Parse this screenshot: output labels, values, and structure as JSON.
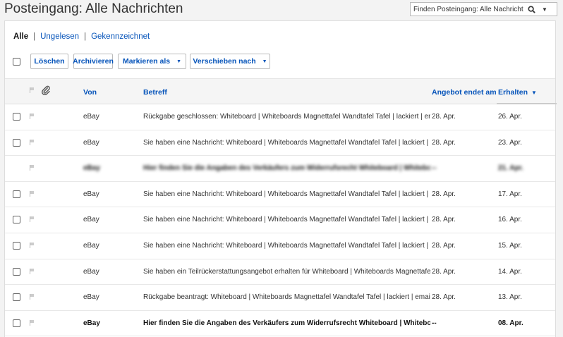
{
  "header": {
    "title": "Posteingang: Alle Nachrichten",
    "search_placeholder": "Finden Posteingang: Alle Nachrichten"
  },
  "filters": {
    "all": "Alle",
    "unread": "Ungelesen",
    "flagged": "Gekennzeichnet",
    "separator": "|"
  },
  "toolbar": {
    "delete": "Löschen",
    "archive": "Archivieren",
    "mark_as": "Markieren als",
    "move_to": "Verschieben nach"
  },
  "table": {
    "columns": {
      "from": "Von",
      "subject": "Betreff",
      "offer_ends": "Angebot endet am",
      "received": "Erhalten"
    },
    "sort_indicator": "▼",
    "rows": [
      {
        "sender": "eBay",
        "subject": "Rückgabe geschlossen: Whiteboard | Whiteboards Magnettafel Wandtafel Tafel | lackiert | emaillier",
        "ends": "28. Apr.",
        "received": "26. Apr.",
        "bold": false,
        "blurred": false
      },
      {
        "sender": "eBay",
        "subject": "Sie haben eine Nachricht: Whiteboard | Whiteboards Magnettafel Wandtafel Tafel | lackiert | emai",
        "ends": "28. Apr.",
        "received": "23. Apr.",
        "bold": false,
        "blurred": false
      },
      {
        "sender": "eBay",
        "subject": "Hier finden Sie die Angaben des Verkäufers zum Widerrufsrecht Whiteboard | Whiteboards Magnettafel",
        "ends": "--",
        "received": "21. Apr.",
        "bold": true,
        "blurred": true
      },
      {
        "sender": "eBay",
        "subject": "Sie haben eine Nachricht: Whiteboard | Whiteboards Magnettafel Wandtafel Tafel | lackiert | emai",
        "ends": "28. Apr.",
        "received": "17. Apr.",
        "bold": false,
        "blurred": false
      },
      {
        "sender": "eBay",
        "subject": "Sie haben eine Nachricht: Whiteboard | Whiteboards Magnettafel Wandtafel Tafel | lackiert | emai",
        "ends": "28. Apr.",
        "received": "16. Apr.",
        "bold": false,
        "blurred": false
      },
      {
        "sender": "eBay",
        "subject": "Sie haben eine Nachricht: Whiteboard | Whiteboards Magnettafel Wandtafel Tafel | lackiert | emai",
        "ends": "28. Apr.",
        "received": "15. Apr.",
        "bold": false,
        "blurred": false
      },
      {
        "sender": "eBay",
        "subject": "Sie haben ein Teilrückerstattungsangebot erhalten für Whiteboard | Whiteboards Magnettafel W",
        "ends": "28. Apr.",
        "received": "14. Apr.",
        "bold": false,
        "blurred": false
      },
      {
        "sender": "eBay",
        "subject": "Rückgabe beantragt: Whiteboard | Whiteboards Magnettafel Wandtafel Tafel | lackiert | emaillier",
        "ends": "28. Apr.",
        "received": "13. Apr.",
        "bold": false,
        "blurred": false
      },
      {
        "sender": "eBay",
        "subject": "Hier finden Sie die Angaben des Verkäufers zum Widerrufsrecht Whiteboard | Whiteboard",
        "ends": "--",
        "received": "08. Apr.",
        "bold": true,
        "blurred": false
      }
    ]
  },
  "icons": {
    "search": "search-icon",
    "dropdown": "caret-down-icon",
    "flag": "flag-icon",
    "attachment": "paperclip-icon"
  },
  "colors": {
    "link": "#0654ba",
    "background": "#f3f3f3"
  }
}
